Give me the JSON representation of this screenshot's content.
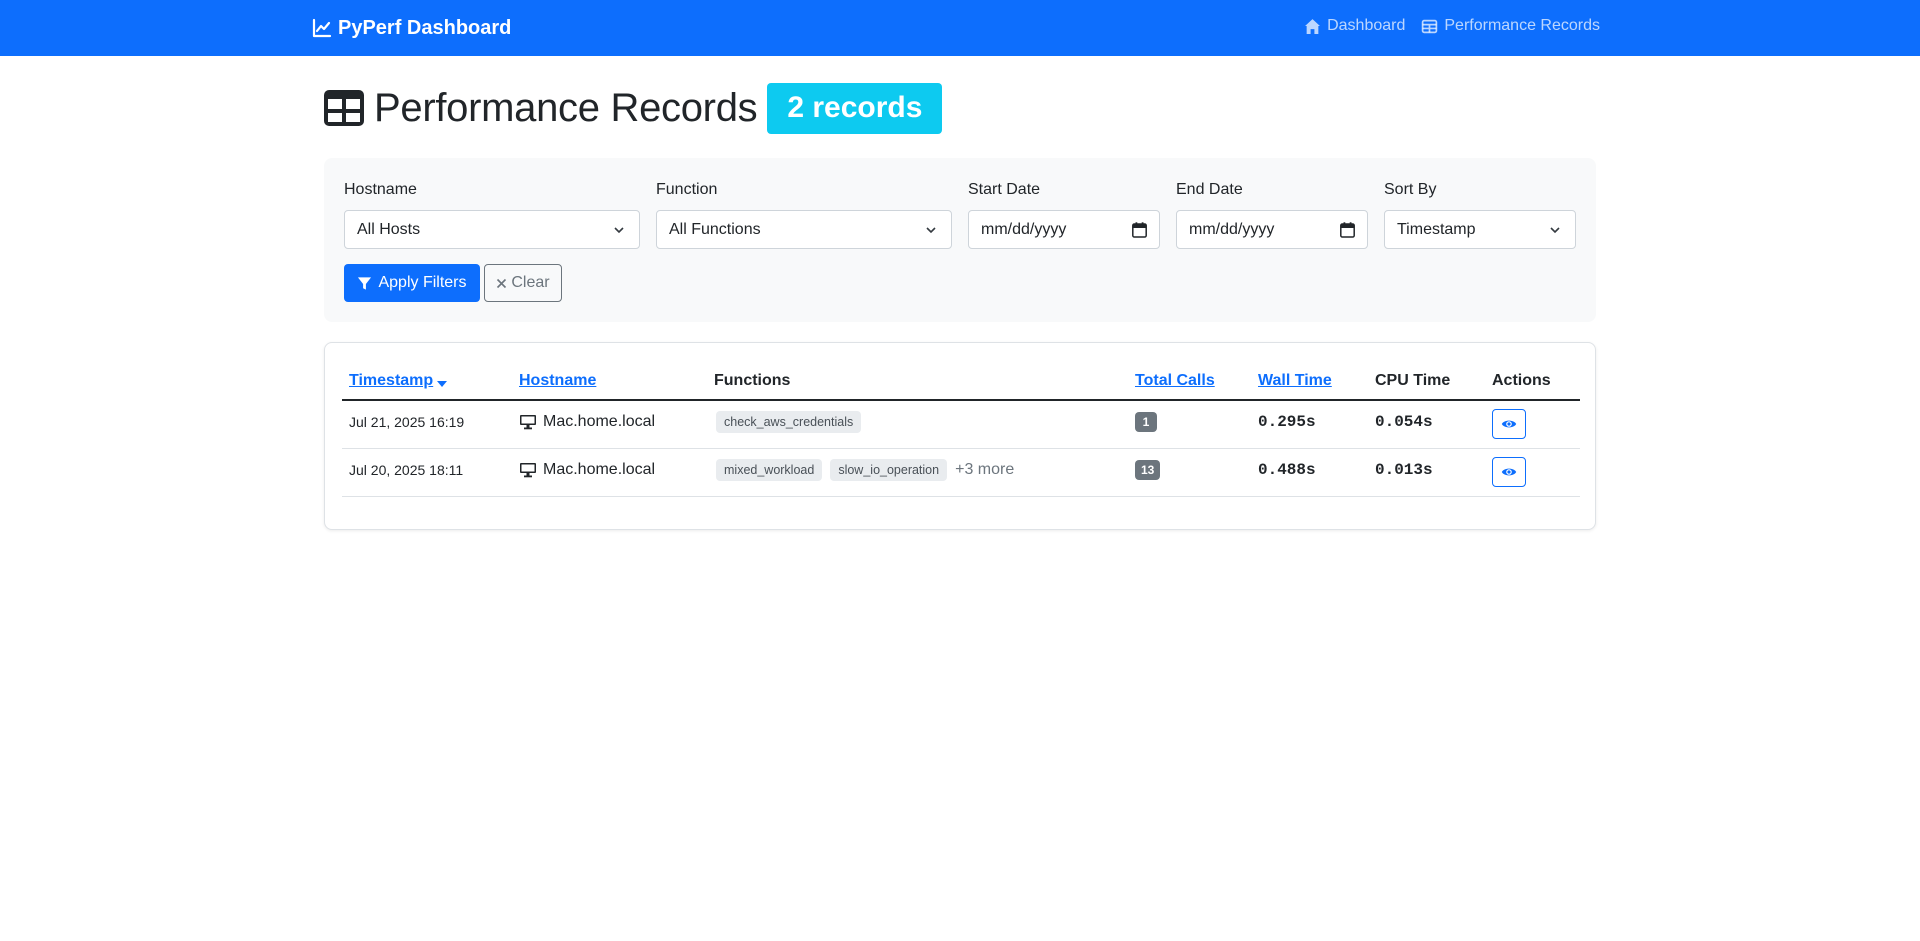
{
  "nav": {
    "brand": "PyPerf Dashboard",
    "links": [
      {
        "label": "Dashboard",
        "icon": "house-icon"
      },
      {
        "label": "Performance Records",
        "icon": "table-icon"
      }
    ]
  },
  "page": {
    "title": "Performance Records",
    "count_badge": "2 records"
  },
  "filters": {
    "hostname": {
      "label": "Hostname",
      "value": "All Hosts"
    },
    "function": {
      "label": "Function",
      "value": "All Functions"
    },
    "start_date": {
      "label": "Start Date",
      "placeholder": "mm/dd/yyyy"
    },
    "end_date": {
      "label": "End Date",
      "placeholder": "mm/dd/yyyy"
    },
    "sort_by": {
      "label": "Sort By",
      "value": "Timestamp"
    },
    "apply_label": "Apply Filters",
    "clear_label": "Clear"
  },
  "table": {
    "headers": {
      "timestamp": "Timestamp",
      "hostname": "Hostname",
      "functions": "Functions",
      "total_calls": "Total Calls",
      "wall_time": "Wall Time",
      "cpu_time": "CPU Time",
      "actions": "Actions"
    },
    "rows": [
      {
        "timestamp": "Jul 21, 2025 16:19",
        "hostname": "Mac.home.local",
        "functions": [
          "check_aws_credentials"
        ],
        "more": "",
        "total_calls": "1",
        "wall_time": "0.295s",
        "cpu_time": "0.054s"
      },
      {
        "timestamp": "Jul 20, 2025 18:11",
        "hostname": "Mac.home.local",
        "functions": [
          "mixed_workload",
          "slow_io_operation"
        ],
        "more": "+3 more",
        "total_calls": "13",
        "wall_time": "0.488s",
        "cpu_time": "0.013s"
      }
    ]
  },
  "colors": {
    "primary": "#0d6efd",
    "info": "#0dcaf0",
    "secondary": "#6c757d",
    "light": "#f8f9fa"
  }
}
